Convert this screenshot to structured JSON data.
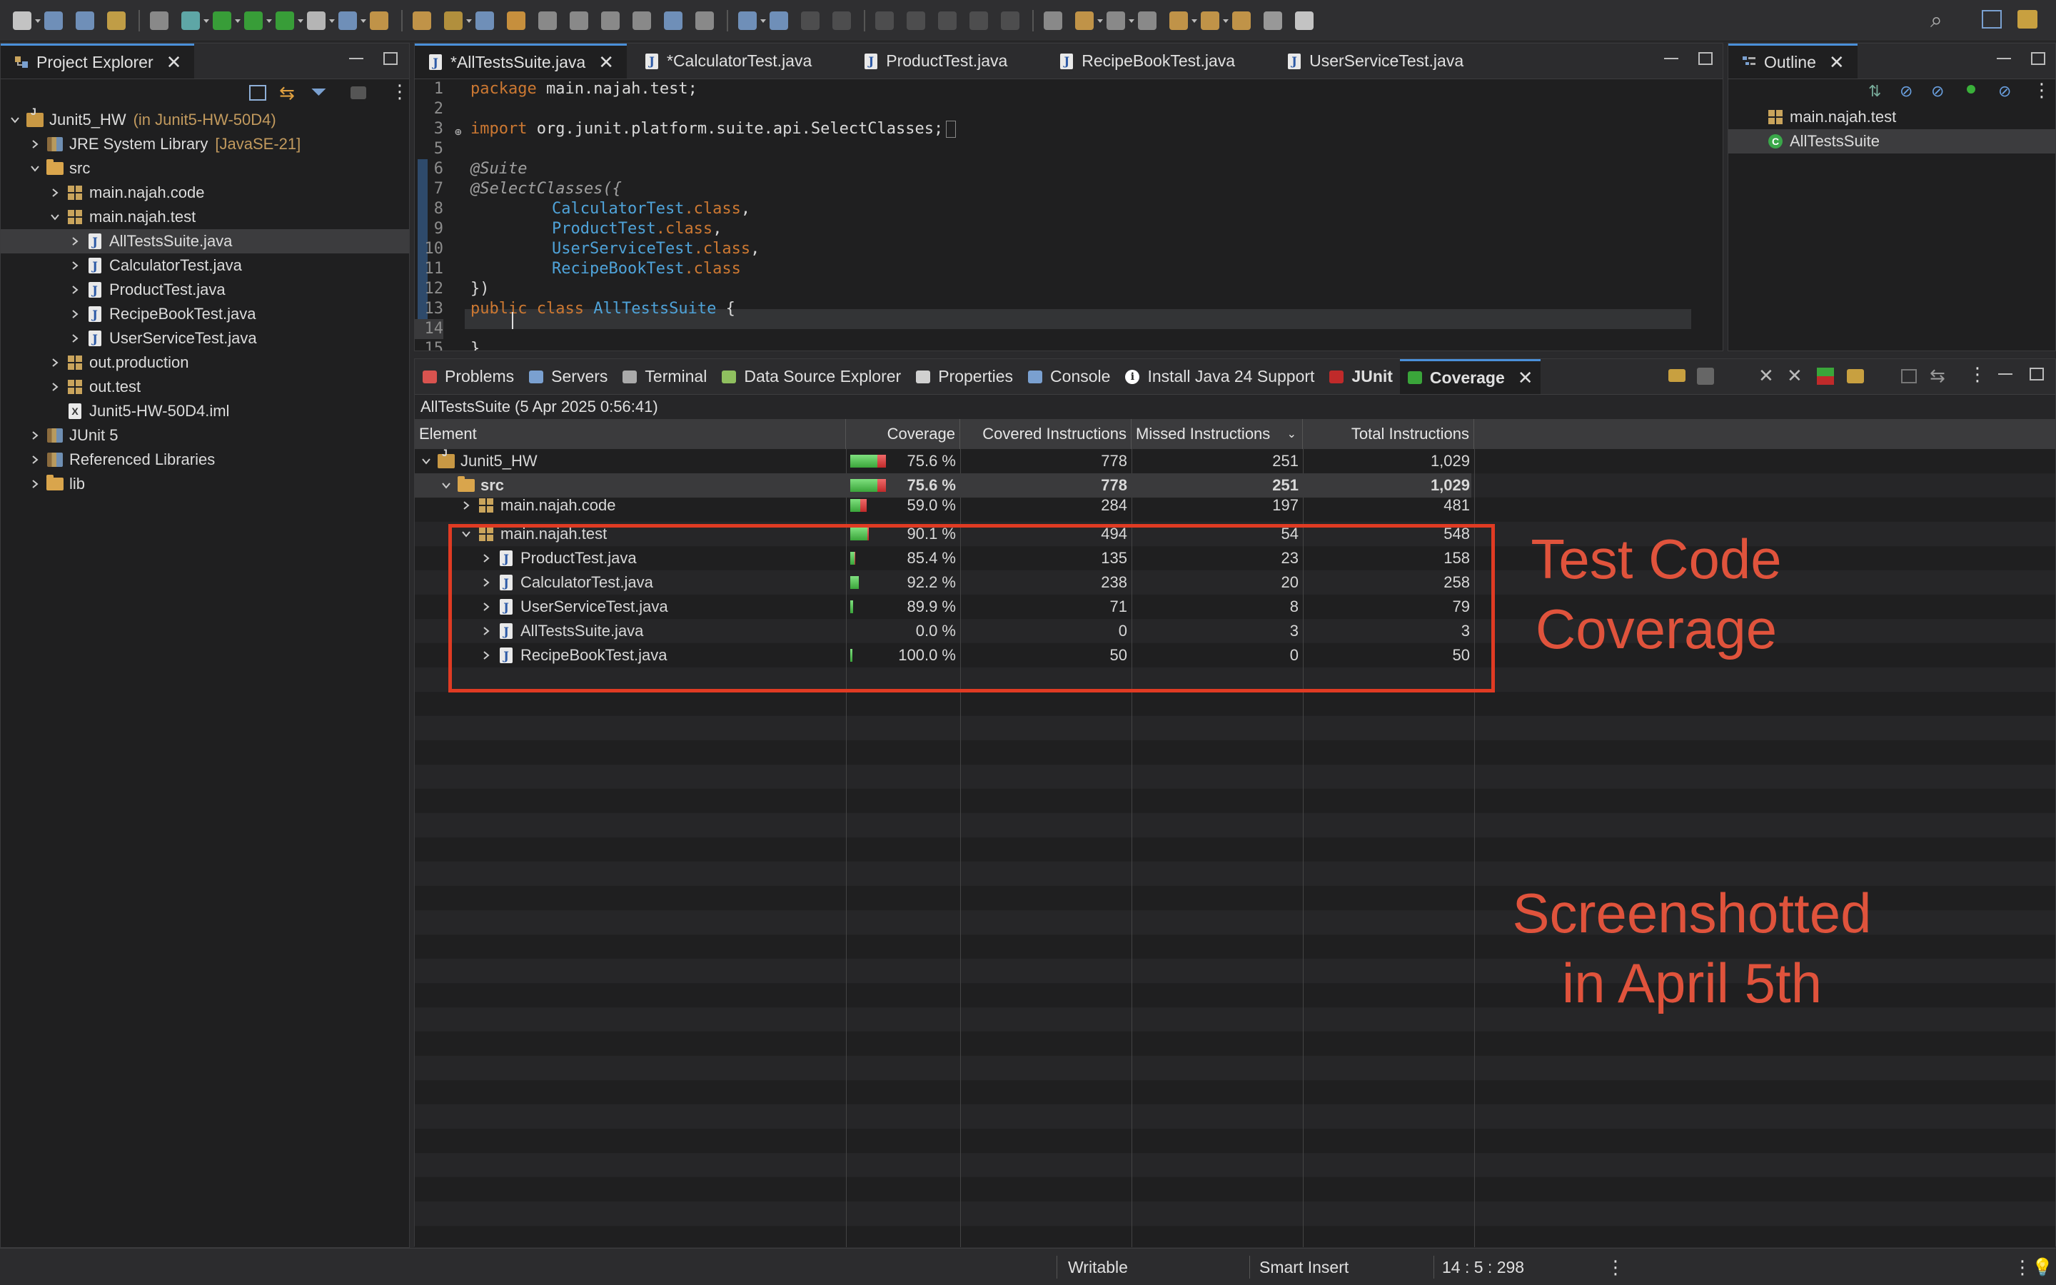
{
  "project_explorer": {
    "title": "Project Explorer",
    "tree": [
      {
        "label": "Junit5_HW",
        "extra": "(in Junit5-HW-50D4)",
        "icon": "project-icon",
        "chev": "v",
        "indent": 0
      },
      {
        "label": "JRE System Library",
        "extra": "[JavaSE-21]",
        "icon": "library-icon",
        "chev": ">",
        "indent": 1
      },
      {
        "label": "src",
        "extra": "",
        "icon": "folder-icon",
        "chev": "v",
        "indent": 1
      },
      {
        "label": "main.najah.code",
        "extra": "",
        "icon": "package-icon",
        "chev": ">",
        "indent": 2
      },
      {
        "label": "main.najah.test",
        "extra": "",
        "icon": "package-icon",
        "chev": "v",
        "indent": 2
      },
      {
        "label": "AllTestsSuite.java",
        "extra": "",
        "icon": "java-file-icon",
        "chev": ">",
        "indent": 3,
        "selected": true
      },
      {
        "label": "CalculatorTest.java",
        "extra": "",
        "icon": "java-file-icon",
        "chev": ">",
        "indent": 3
      },
      {
        "label": "ProductTest.java",
        "extra": "",
        "icon": "java-file-icon",
        "chev": ">",
        "indent": 3
      },
      {
        "label": "RecipeBookTest.java",
        "extra": "",
        "icon": "java-file-icon",
        "chev": ">",
        "indent": 3
      },
      {
        "label": "UserServiceTest.java",
        "extra": "",
        "icon": "java-file-icon",
        "chev": ">",
        "indent": 3
      },
      {
        "label": "out.production",
        "extra": "",
        "icon": "package-icon",
        "chev": ">",
        "indent": 2
      },
      {
        "label": "out.test",
        "extra": "",
        "icon": "package-icon",
        "chev": ">",
        "indent": 2
      },
      {
        "label": "Junit5-HW-50D4.iml",
        "extra": "",
        "icon": "xml-file-icon",
        "chev": "",
        "indent": 2
      },
      {
        "label": "JUnit 5",
        "extra": "",
        "icon": "library-icon",
        "chev": ">",
        "indent": 1
      },
      {
        "label": "Referenced Libraries",
        "extra": "",
        "icon": "library-icon",
        "chev": ">",
        "indent": 1
      },
      {
        "label": "lib",
        "extra": "",
        "icon": "folder-icon",
        "chev": ">",
        "indent": 1
      }
    ]
  },
  "editor": {
    "tabs": [
      "*AllTestsSuite.java",
      "*CalculatorTest.java",
      "ProductTest.java",
      "RecipeBookTest.java",
      "UserServiceTest.java"
    ],
    "active_tab": "*AllTestsSuite.java",
    "line_numbers": [
      "1",
      "2",
      "3",
      "5",
      "6",
      "7",
      "8",
      "9",
      "10",
      "11",
      "12",
      "13",
      "14",
      "15"
    ],
    "lines": {
      "l1_kw": "package",
      "l1_rest": " main.najah.test;",
      "l3_kw": "import",
      "l3_rest": " org.junit.platform.suite.api.SelectClasses;",
      "l6": "@Suite",
      "l7": "@SelectClasses({",
      "l8_cls": "CalculatorTest",
      "l9_cls": "ProductTest",
      "l10_cls": "UserServiceTest",
      "l11_cls": "RecipeBookTest",
      "dot_class": ".class",
      "comma": ",",
      "l12": "})",
      "l13_kw1": "public",
      "l13_kw2": "class",
      "l13_cls": "AllTestsSuite",
      "l13_rest": " {",
      "l15": "}"
    }
  },
  "outline": {
    "title": "Outline",
    "items": [
      "main.najah.test",
      "AllTestsSuite"
    ]
  },
  "bottom_tabs": [
    "Problems",
    "Servers",
    "Terminal",
    "Data Source Explorer",
    "Properties",
    "Console",
    "Install Java 24 Support",
    "JUnit",
    "Coverage"
  ],
  "coverage": {
    "session": "AllTestsSuite (5 Apr 2025 0:56:41)",
    "columns": [
      "Element",
      "Coverage",
      "Covered Instructions",
      "Missed Instructions",
      "Total Instructions"
    ],
    "rows": [
      {
        "name": "Junit5_HW",
        "icon": "project-icon",
        "chev": "v",
        "indent": 0,
        "coverage": "75.6 %",
        "covered": "778",
        "missed": "251",
        "total": "1,029",
        "pct": 0.756,
        "size": 1.0
      },
      {
        "name": "src",
        "icon": "folder-icon",
        "chev": "v",
        "indent": 1,
        "coverage": "75.6 %",
        "covered": "778",
        "missed": "251",
        "total": "1,029",
        "pct": 0.756,
        "size": 1.0
      },
      {
        "name": "main.najah.code",
        "icon": "package-icon",
        "chev": ">",
        "indent": 2,
        "coverage": "59.0 %",
        "covered": "284",
        "missed": "197",
        "total": "481",
        "pct": 0.59,
        "size": 0.47
      },
      {
        "name": "main.najah.test",
        "icon": "package-icon",
        "chev": "v",
        "indent": 2,
        "coverage": "90.1 %",
        "covered": "494",
        "missed": "54",
        "total": "548",
        "pct": 0.901,
        "size": 0.53
      },
      {
        "name": "ProductTest.java",
        "icon": "java-file-icon",
        "chev": ">",
        "indent": 3,
        "coverage": "85.4 %",
        "covered": "135",
        "missed": "23",
        "total": "158",
        "pct": 0.854,
        "size": 0.15
      },
      {
        "name": "CalculatorTest.java",
        "icon": "java-file-icon",
        "chev": ">",
        "indent": 3,
        "coverage": "92.2 %",
        "covered": "238",
        "missed": "20",
        "total": "258",
        "pct": 0.922,
        "size": 0.25
      },
      {
        "name": "UserServiceTest.java",
        "icon": "java-file-icon",
        "chev": ">",
        "indent": 3,
        "coverage": "89.9 %",
        "covered": "71",
        "missed": "8",
        "total": "79",
        "pct": 0.899,
        "size": 0.08
      },
      {
        "name": "AllTestsSuite.java",
        "icon": "java-file-icon",
        "chev": ">",
        "indent": 3,
        "coverage": "0.0 %",
        "covered": "0",
        "missed": "3",
        "total": "3",
        "pct": 0.0,
        "size": 0.0
      },
      {
        "name": "RecipeBookTest.java",
        "icon": "java-file-icon",
        "chev": ">",
        "indent": 3,
        "coverage": "100.0 %",
        "covered": "50",
        "missed": "0",
        "total": "50",
        "pct": 1.0,
        "size": 0.05
      }
    ]
  },
  "annotations": {
    "box_label": [
      "Test Code",
      "Coverage"
    ],
    "note": [
      "Screenshotted",
      "in April 5th"
    ]
  },
  "status": {
    "mode": "Writable",
    "insert": "Smart Insert",
    "position": "14 : 5 : 298"
  },
  "colors": {
    "accent": "#4a90d9",
    "annotation": "#e0533c",
    "bar_covered": "#3aa53a",
    "bar_missed": "#c02a2a"
  }
}
